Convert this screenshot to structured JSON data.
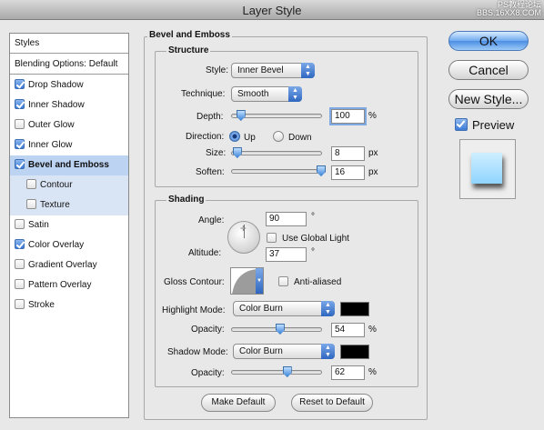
{
  "window": {
    "title": "Layer Style",
    "watermark_line1": "PS教程论坛",
    "watermark_line2": "BBS.16XX8.COM"
  },
  "sidebar": {
    "header": "Styles",
    "blending": "Blending Options: Default",
    "items": [
      {
        "label": "Drop Shadow",
        "checked": true
      },
      {
        "label": "Inner Shadow",
        "checked": true
      },
      {
        "label": "Outer Glow",
        "checked": false
      },
      {
        "label": "Inner Glow",
        "checked": true
      },
      {
        "label": "Bevel and Emboss",
        "checked": true,
        "selected": true
      },
      {
        "label": "Contour",
        "checked": false,
        "sub": true
      },
      {
        "label": "Texture",
        "checked": false,
        "sub": true
      },
      {
        "label": "Satin",
        "checked": false
      },
      {
        "label": "Color Overlay",
        "checked": true
      },
      {
        "label": "Gradient Overlay",
        "checked": false
      },
      {
        "label": "Pattern Overlay",
        "checked": false
      },
      {
        "label": "Stroke",
        "checked": false
      }
    ]
  },
  "bevel": {
    "section_title": "Bevel and Emboss",
    "structure": {
      "title": "Structure",
      "style_label": "Style:",
      "style_value": "Inner Bevel",
      "technique_label": "Technique:",
      "technique_value": "Smooth",
      "depth_label": "Depth:",
      "depth_value": "100",
      "depth_unit": "%",
      "depth_level": 0.1,
      "direction_label": "Direction:",
      "dir_up": "Up",
      "dir_down": "Down",
      "size_label": "Size:",
      "size_value": "8",
      "size_unit": "px",
      "size_level": 0.06,
      "soften_label": "Soften:",
      "soften_value": "16",
      "soften_unit": "px",
      "soften_level": 1.0
    },
    "shading": {
      "title": "Shading",
      "angle_label": "Angle:",
      "angle_value": "90",
      "deg": "°",
      "use_global_light": "Use Global Light",
      "altitude_label": "Altitude:",
      "altitude_value": "37",
      "gloss_label": "Gloss Contour:",
      "anti_aliased": "Anti-aliased",
      "highlight_label": "Highlight Mode:",
      "highlight_value": "Color Burn",
      "highlight_color": "#000000",
      "opacity_label": "Opacity:",
      "highlight_opacity": "54",
      "highlight_level": 0.54,
      "shadow_label": "Shadow Mode:",
      "shadow_value": "Color Burn",
      "shadow_color": "#000000",
      "shadow_opacity": "62",
      "shadow_level": 0.62,
      "pct": "%"
    },
    "make_default": "Make Default",
    "reset_default": "Reset to Default"
  },
  "actions": {
    "ok": "OK",
    "cancel": "Cancel",
    "new_style": "New Style...",
    "preview": "Preview"
  }
}
